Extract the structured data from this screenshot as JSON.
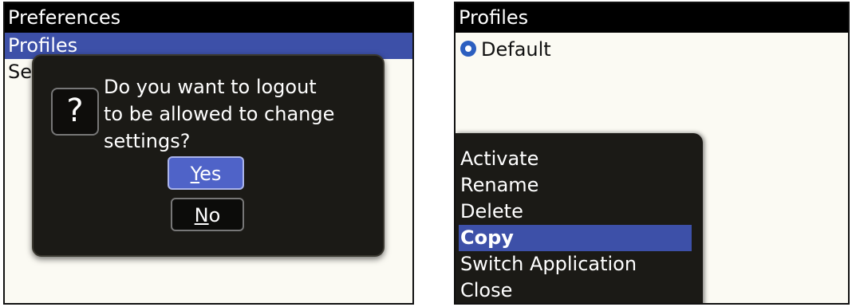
{
  "left": {
    "title": "Preferences",
    "list": [
      {
        "label": "Profiles"
      },
      {
        "label": "Setup"
      }
    ],
    "dialog": {
      "message_lines": [
        "Do you want to logout",
        "to be allowed to change",
        "settings?"
      ],
      "yes_mnemonic": "Y",
      "yes_rest": "es",
      "no_mnemonic": "N",
      "no_rest": "o",
      "icon_glyph": "?"
    }
  },
  "right": {
    "title": "Profiles",
    "radio_label": "Default",
    "menu": [
      {
        "label": "Activate"
      },
      {
        "label": "Rename"
      },
      {
        "label": "Delete"
      },
      {
        "label": "Copy"
      },
      {
        "label": "Switch Application"
      },
      {
        "label": "Close"
      }
    ]
  },
  "colors": {
    "selection": "#3d50a8",
    "dialog_bg": "#1b1a16",
    "screen_bg": "#fbfaf3"
  }
}
